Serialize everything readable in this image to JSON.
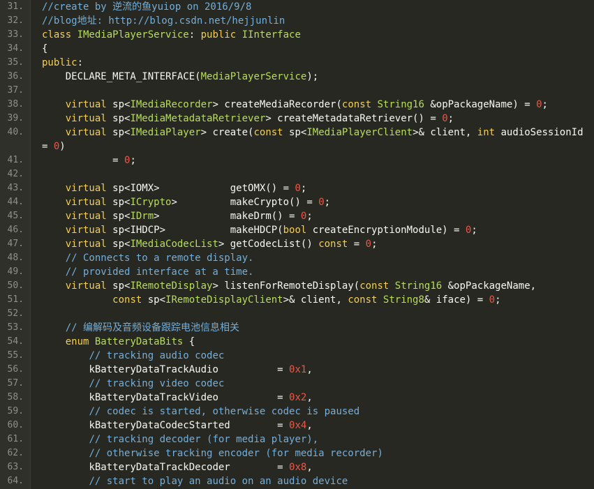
{
  "colors": {
    "background": "#272822",
    "comment": "#75aed8",
    "keyword": "#f2cf55",
    "type": "#b9dd5a",
    "number": "#e45a4a",
    "plain": "#f8f8f2",
    "line_number": "#8f908a"
  },
  "lines": [
    {
      "n": "31.",
      "tokens": [
        [
          "c",
          "//create by 逆流的鱼yuiop on 2016/9/8"
        ]
      ]
    },
    {
      "n": "32.",
      "tokens": [
        [
          "c",
          "//blog地址: http://blog.csdn.net/hejjunlin"
        ]
      ]
    },
    {
      "n": "33.",
      "tokens": [
        [
          "k",
          "class "
        ],
        [
          "t",
          "IMediaPlayerService"
        ],
        [
          "p",
          ": "
        ],
        [
          "k",
          "public "
        ],
        [
          "t",
          "IInterface"
        ]
      ]
    },
    {
      "n": "34.",
      "tokens": [
        [
          "p",
          "{"
        ]
      ]
    },
    {
      "n": "35.",
      "tokens": [
        [
          "k",
          "public"
        ],
        [
          "p",
          ":"
        ]
      ]
    },
    {
      "n": "36.",
      "tokens": [
        [
          "p",
          "    DECLARE_META_INTERFACE("
        ],
        [
          "t",
          "MediaPlayerService"
        ],
        [
          "p",
          ");"
        ]
      ]
    },
    {
      "n": "37.",
      "tokens": []
    },
    {
      "n": "38.",
      "tokens": [
        [
          "k",
          "    virtual "
        ],
        [
          "p",
          "sp<"
        ],
        [
          "t",
          "IMediaRecorder"
        ],
        [
          "p",
          "> createMediaRecorder("
        ],
        [
          "k",
          "const "
        ],
        [
          "t",
          "String16 "
        ],
        [
          "p",
          "&opPackageName) = "
        ],
        [
          "n",
          "0"
        ],
        [
          "p",
          ";"
        ]
      ]
    },
    {
      "n": "39.",
      "tokens": [
        [
          "k",
          "    virtual "
        ],
        [
          "p",
          "sp<"
        ],
        [
          "t",
          "IMediaMetadataRetriever"
        ],
        [
          "p",
          "> createMetadataRetriever() = "
        ],
        [
          "n",
          "0"
        ],
        [
          "p",
          ";"
        ]
      ]
    },
    {
      "n": "40.",
      "wrap": true,
      "tokens": [
        [
          "k",
          "    virtual "
        ],
        [
          "p",
          "sp<"
        ],
        [
          "t",
          "IMediaPlayer"
        ],
        [
          "p",
          "> create("
        ],
        [
          "k",
          "const "
        ],
        [
          "p",
          "sp<"
        ],
        [
          "t",
          "IMediaPlayerClient"
        ],
        [
          "p",
          ">& client, "
        ],
        [
          "k",
          "int "
        ],
        [
          "p",
          "audioSessionId = "
        ],
        [
          "n",
          "0"
        ],
        [
          "p",
          ")"
        ]
      ]
    },
    {
      "n": "41.",
      "tokens": [
        [
          "p",
          "            = "
        ],
        [
          "n",
          "0"
        ],
        [
          "p",
          ";"
        ]
      ]
    },
    {
      "n": "42.",
      "tokens": []
    },
    {
      "n": "43.",
      "tokens": [
        [
          "k",
          "    virtual "
        ],
        [
          "p",
          "sp<IOMX>            getOMX() = "
        ],
        [
          "n",
          "0"
        ],
        [
          "p",
          ";"
        ]
      ]
    },
    {
      "n": "44.",
      "tokens": [
        [
          "k",
          "    virtual "
        ],
        [
          "p",
          "sp<"
        ],
        [
          "t",
          "ICrypto"
        ],
        [
          "p",
          ">         makeCrypto() = "
        ],
        [
          "n",
          "0"
        ],
        [
          "p",
          ";"
        ]
      ]
    },
    {
      "n": "45.",
      "tokens": [
        [
          "k",
          "    virtual "
        ],
        [
          "p",
          "sp<"
        ],
        [
          "t",
          "IDrm"
        ],
        [
          "p",
          ">            makeDrm() = "
        ],
        [
          "n",
          "0"
        ],
        [
          "p",
          ";"
        ]
      ]
    },
    {
      "n": "46.",
      "tokens": [
        [
          "k",
          "    virtual "
        ],
        [
          "p",
          "sp<IHDCP>           makeHDCP("
        ],
        [
          "k",
          "bool "
        ],
        [
          "p",
          "createEncryptionModule) = "
        ],
        [
          "n",
          "0"
        ],
        [
          "p",
          ";"
        ]
      ]
    },
    {
      "n": "47.",
      "tokens": [
        [
          "k",
          "    virtual "
        ],
        [
          "p",
          "sp<"
        ],
        [
          "t",
          "IMediaCodecList"
        ],
        [
          "p",
          "> getCodecList() "
        ],
        [
          "k",
          "const "
        ],
        [
          "p",
          "= "
        ],
        [
          "n",
          "0"
        ],
        [
          "p",
          ";"
        ]
      ]
    },
    {
      "n": "48.",
      "tokens": [
        [
          "c",
          "    // Connects to a remote display."
        ]
      ]
    },
    {
      "n": "49.",
      "tokens": [
        [
          "c",
          "    // provided interface at a time."
        ]
      ]
    },
    {
      "n": "50.",
      "tokens": [
        [
          "k",
          "    virtual "
        ],
        [
          "p",
          "sp<"
        ],
        [
          "t",
          "IRemoteDisplay"
        ],
        [
          "p",
          "> listenForRemoteDisplay("
        ],
        [
          "k",
          "const "
        ],
        [
          "t",
          "String16 "
        ],
        [
          "p",
          "&opPackageName,"
        ]
      ]
    },
    {
      "n": "51.",
      "tokens": [
        [
          "k",
          "            const "
        ],
        [
          "p",
          "sp<"
        ],
        [
          "t",
          "IRemoteDisplayClient"
        ],
        [
          "p",
          ">& client, "
        ],
        [
          "k",
          "const "
        ],
        [
          "t",
          "String8"
        ],
        [
          "p",
          "& iface) = "
        ],
        [
          "n",
          "0"
        ],
        [
          "p",
          ";"
        ]
      ]
    },
    {
      "n": "52.",
      "tokens": []
    },
    {
      "n": "53.",
      "tokens": [
        [
          "c",
          "    // 编解码及音频设备跟踪电池信息相关"
        ]
      ]
    },
    {
      "n": "54.",
      "tokens": [
        [
          "k",
          "    enum "
        ],
        [
          "t",
          "BatteryDataBits "
        ],
        [
          "p",
          "{"
        ]
      ]
    },
    {
      "n": "55.",
      "tokens": [
        [
          "c",
          "        // tracking audio codec"
        ]
      ]
    },
    {
      "n": "56.",
      "tokens": [
        [
          "p",
          "        kBatteryDataTrackAudio          = "
        ],
        [
          "n",
          "0x1"
        ],
        [
          "p",
          ","
        ]
      ]
    },
    {
      "n": "57.",
      "tokens": [
        [
          "c",
          "        // tracking video codec"
        ]
      ]
    },
    {
      "n": "58.",
      "tokens": [
        [
          "p",
          "        kBatteryDataTrackVideo          = "
        ],
        [
          "n",
          "0x2"
        ],
        [
          "p",
          ","
        ]
      ]
    },
    {
      "n": "59.",
      "tokens": [
        [
          "c",
          "        // codec is started, otherwise codec is paused"
        ]
      ]
    },
    {
      "n": "60.",
      "tokens": [
        [
          "p",
          "        kBatteryDataCodecStarted        = "
        ],
        [
          "n",
          "0x4"
        ],
        [
          "p",
          ","
        ]
      ]
    },
    {
      "n": "61.",
      "tokens": [
        [
          "c",
          "        // tracking decoder (for media player),"
        ]
      ]
    },
    {
      "n": "62.",
      "tokens": [
        [
          "c",
          "        // otherwise tracking encoder (for media recorder)"
        ]
      ]
    },
    {
      "n": "63.",
      "tokens": [
        [
          "p",
          "        kBatteryDataTrackDecoder        = "
        ],
        [
          "n",
          "0x8"
        ],
        [
          "p",
          ","
        ]
      ]
    },
    {
      "n": "64.",
      "tokens": [
        [
          "c",
          "        // start to play an audio on an audio device"
        ]
      ]
    }
  ]
}
